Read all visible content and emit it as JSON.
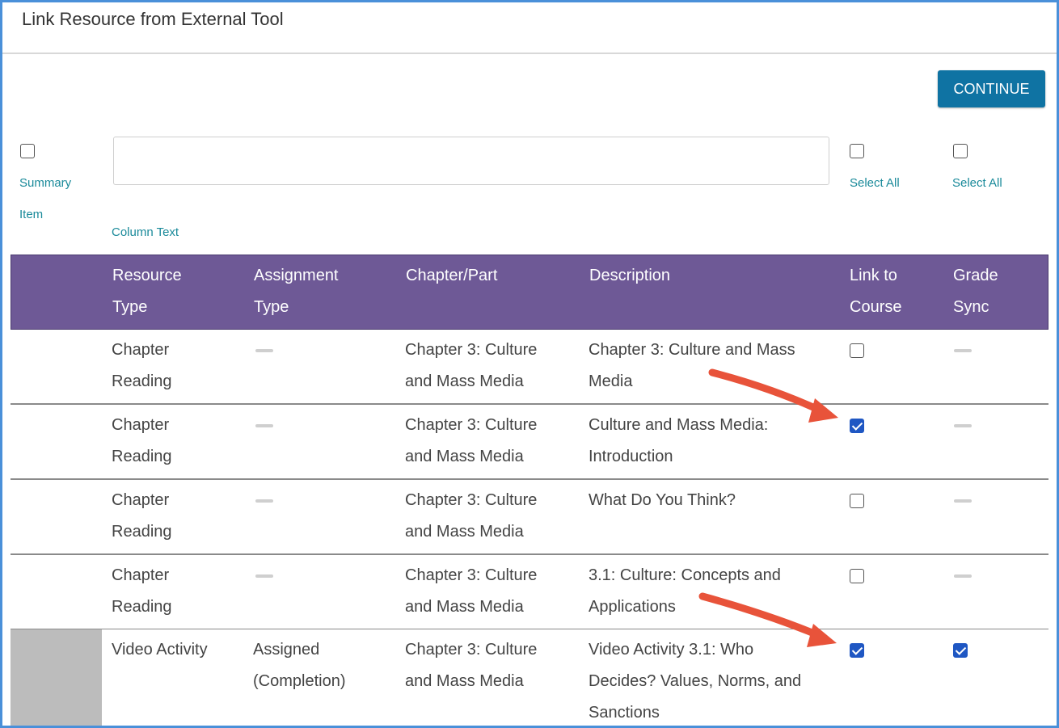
{
  "dialog": {
    "title": "Link Resource from External Tool",
    "continue_label": "CONTINUE"
  },
  "filters": {
    "summary_item_label_line1": "Summary",
    "summary_item_label_line2": "Item",
    "summary_item_checked": false,
    "column_text_label": "Column Text",
    "column_text_value": "",
    "link_select_all_label": "Select All",
    "link_select_all_checked": false,
    "grade_select_all_label": "Select All",
    "grade_select_all_checked": false
  },
  "table": {
    "headers": {
      "resource_type_1": "Resource",
      "resource_type_2": "Type",
      "assignment_type_1": "Assignment",
      "assignment_type_2": "Type",
      "chapter_part": "Chapter/Part",
      "description": "Description",
      "link_to_course_1": "Link to",
      "link_to_course_2": "Course",
      "grade_sync_1": "Grade",
      "grade_sync_2": "Sync"
    },
    "rows": [
      {
        "resource_type_1": "Chapter",
        "resource_type_2": "Reading",
        "chapter_1": "Chapter 3: Culture",
        "chapter_2": "and Mass Media",
        "description_1": "Chapter 3: Culture and Mass",
        "description_2": "Media",
        "link_checked": false
      },
      {
        "resource_type_1": "Chapter",
        "resource_type_2": "Reading",
        "chapter_1": "Chapter 3: Culture",
        "chapter_2": "and Mass Media",
        "description_1": "Culture and Mass Media:",
        "description_2": "Introduction",
        "link_checked": true
      },
      {
        "resource_type_1": "Chapter",
        "resource_type_2": "Reading",
        "chapter_1": "Chapter 3: Culture",
        "chapter_2": "and Mass Media",
        "description_1": "What Do You Think?",
        "description_2": "",
        "link_checked": false
      },
      {
        "resource_type_1": "Chapter",
        "resource_type_2": "Reading",
        "chapter_1": "Chapter 3: Culture",
        "chapter_2": "and Mass Media",
        "description_1": "3.1: Culture: Concepts and",
        "description_2": "Applications",
        "link_checked": false
      },
      {
        "resource_type_1": "Video Activity",
        "assignment_type_1": "Assigned",
        "assignment_type_2": "(Completion)",
        "chapter_1": "Chapter 3: Culture",
        "chapter_2": "and Mass Media",
        "description_1": "Video Activity 3.1: Who",
        "description_2": "Decides? Values, Norms, and",
        "description_3": "Sanctions",
        "link_checked": true,
        "grade_checked": true
      }
    ]
  },
  "colors": {
    "header_bg": "#6e5996",
    "continue_bg": "#0f73a3",
    "link_text": "#1a8a9a",
    "checkbox_checked": "#1f57c3",
    "arrow": "#e8533a"
  }
}
